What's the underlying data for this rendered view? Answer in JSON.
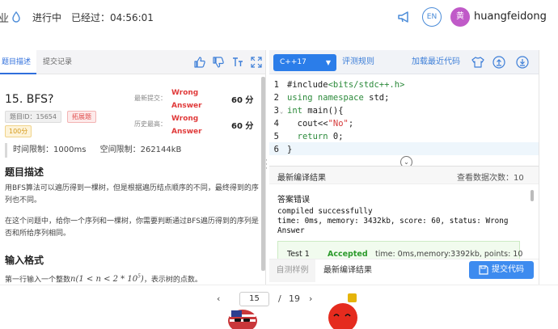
{
  "topbar": {
    "truncated_text": "业",
    "status_text": "进行中",
    "elapsed_label": "已经过：",
    "elapsed_value": "04:56:01",
    "lang_button": "EN",
    "avatar_text": "黄",
    "username": "huangfeidong"
  },
  "left_panel": {
    "tabs": [
      "题目描述",
      "提交记录"
    ],
    "problem": {
      "title": "15.  BFS?",
      "id_label": "题目ID：15654",
      "tag": "拓展题",
      "score_tag": "100分",
      "latest_label": "最新提交：",
      "latest_verdict": "Wrong Answer",
      "latest_score": "60 分",
      "best_label": "历史最高：",
      "best_verdict": "Wrong Answer",
      "best_score": "60 分"
    },
    "limits": {
      "time": "时间限制：1000ms",
      "memory": "空间限制：262144kB"
    },
    "sections": {
      "desc_title": "题目描述",
      "desc_p1": "用BFS算法可以遍历得到一棵树，但是根据遍历结点顺序的不同，最终得到的序列也不同。",
      "desc_p2": "在这个问题中，给你一个序列和一棵树，你需要判断通过BFS遍历得到的序列是否和所给序列相同。",
      "input_title": "输入格式",
      "input_p1": "第一行输入一个整数",
      "input_math": "n(1 < n < 2 * 10",
      "input_math_sup": "5",
      "input_math_tail": ")",
      "input_p1_tail": "，表示树的点数。"
    }
  },
  "editor": {
    "language": "C++17",
    "eval_rules": "评测规则",
    "load_latest": "加载最近代码",
    "code_lines": [
      {
        "num": "1",
        "pre": "#include",
        "inc": "<bits/stdc++.h>"
      },
      {
        "num": "2",
        "kw": "using namespace",
        "rest": " std;"
      },
      {
        "num": "3",
        "kw": "int",
        "rest": " main(){"
      },
      {
        "num": "4",
        "pre": "  cout<<",
        "str": "\"No\"",
        "rest": ";"
      },
      {
        "num": "5",
        "kw": "  return",
        "rest": " 0;"
      },
      {
        "num": "6",
        "rest": "}"
      }
    ]
  },
  "result": {
    "title": "最新编译结果",
    "count_label": "查看数据次数：10",
    "error_title": "答案错误",
    "line1": "compiled successfully",
    "line2": "time: 0ms, memory: 3432kb, score: 60, status: Wrong",
    "line3": "Answer",
    "testcase": {
      "name": "Test 1",
      "verdict": "Accepted",
      "detail": "time: 0ms,memory:3392kb, points: 10"
    },
    "tabs": [
      "自测样例",
      "最新编译结果"
    ],
    "submit": "提交代码"
  },
  "pager": {
    "current": "15",
    "separator": "/",
    "total": "19"
  },
  "colors": {
    "accent": "#2b7de9",
    "wrong": "#e03a3a",
    "accepted": "#2c9a2c",
    "avatar": "#c05ac8"
  }
}
